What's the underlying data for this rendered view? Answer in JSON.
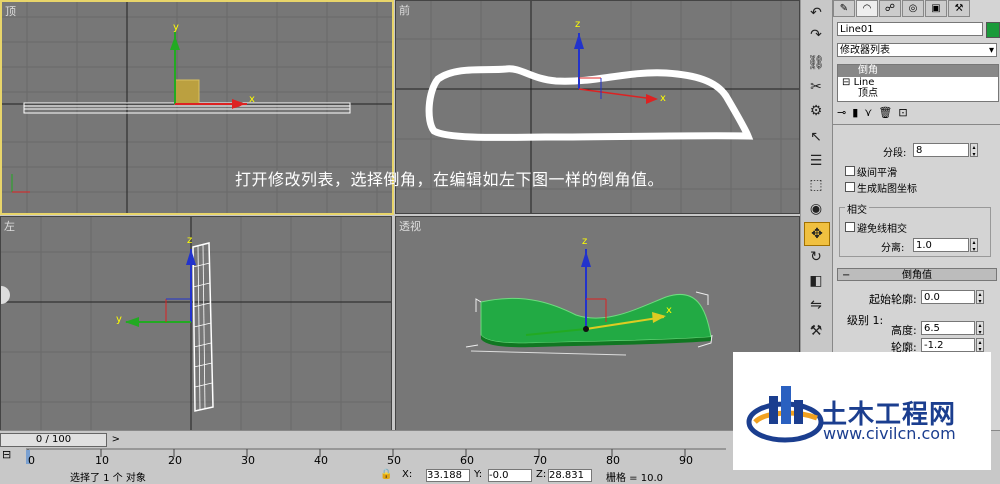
{
  "viewports": {
    "top": {
      "label": "顶"
    },
    "front": {
      "label": "前"
    },
    "left": {
      "label": "左"
    },
    "perspective": {
      "label": "透视"
    }
  },
  "overlay_text": "打开修改列表，选择倒角，在编辑如左下图一样的倒角值。",
  "axis_labels": {
    "x": "x",
    "y": "y",
    "z": "z"
  },
  "toolbar": {
    "items": [
      "undo-icon",
      "redo-icon",
      "link-icon",
      "unlink-icon",
      "bind-icon",
      "select-icon",
      "select-name-icon",
      "select-region-icon",
      "window-crossing-icon",
      "move-icon",
      "rotate-icon",
      "scale-icon",
      "mirror-icon",
      "snap-icon"
    ],
    "active": "move-icon",
    "accent": "#f0c040"
  },
  "panel": {
    "tabs": [
      "create",
      "modify",
      "hierarchy",
      "motion",
      "display",
      "utilities"
    ],
    "object_name": "Line01",
    "object_color": "#1a9a3a",
    "modifier_list_label": "修改器列表",
    "stack": [
      {
        "label": "倒角",
        "selected": true
      },
      {
        "label": "Line",
        "selected": false
      },
      {
        "label": "顶点",
        "selected": false
      }
    ],
    "segments_label": "分段:",
    "segments_value": "8",
    "level_smooth_label": "级间平滑",
    "gen_map_label": "生成贴图坐标",
    "intersect_group": "相交",
    "avoid_intersect_label": "避免线相交",
    "separation_label": "分离:",
    "separation_value": "1.0",
    "bevel_values_header": "倒角值",
    "start_outline_label": "起始轮廓:",
    "start_outline_value": "0.0",
    "level1_label": "级别 1:",
    "height_label": "高度:",
    "height_value": "6.5",
    "outline_label": "轮廓:",
    "outline_value": "-1.2"
  },
  "timeline": {
    "frame_display": "0 / 100",
    "ticks": [
      "0",
      "10",
      "20",
      "30",
      "40",
      "50",
      "60",
      "70",
      "80",
      "90"
    ],
    "status_text": "选择了 1 个 对象",
    "x_label": "X:",
    "x_value": "33.188",
    "y_label": "Y:",
    "y_value": "-0.0",
    "z_label": "Z:",
    "z_value": "28.831",
    "grid_label": "栅格 = 10.0"
  },
  "watermark": {
    "title": "土木工程网",
    "url": "www.civilcn.com"
  }
}
